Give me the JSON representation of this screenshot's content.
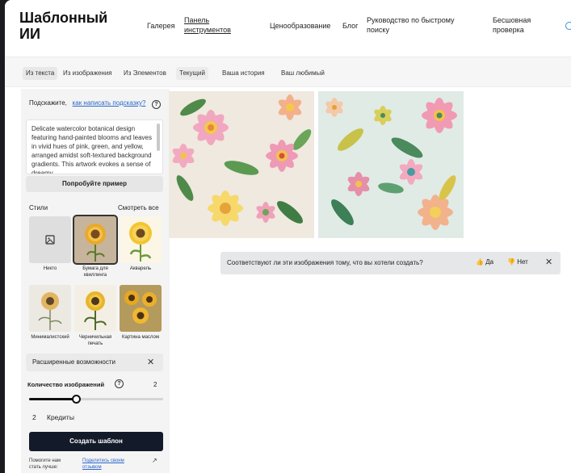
{
  "app": {
    "brand": "Шаблонный ИИ"
  },
  "nav": {
    "gallery": "Галерея",
    "dashboard": "Панель инструментов",
    "pricing": "Ценообразование",
    "blog": "Блог",
    "quick_guide": "Руководство по быстрому поиску",
    "seamless_check": "Бесшовная проверка"
  },
  "tabs": {
    "source": [
      "Из текста",
      "Из изображения",
      "Из Элементов"
    ],
    "history": [
      "Текущий",
      "Ваша история",
      "Ваш любимый"
    ]
  },
  "prompt": {
    "hint_prefix": "Подскажите,",
    "hint_link": "как написать подсказку?",
    "text": "Delicate watercolor botanical design featuring hand-painted blooms and leaves in vivid hues of pink, green, and yellow, arranged amidst soft-textured background gradients. This artwork evokes a sense of dreamy",
    "try_example": "Попробуйте пример"
  },
  "styles": {
    "label": "Стили",
    "see_all": "Смотреть все",
    "items": [
      {
        "label": "Никто"
      },
      {
        "label": "Бумага для квиллинга"
      },
      {
        "label": "Акварель"
      },
      {
        "label": "Минималистский"
      },
      {
        "label": "Черничильная печать"
      },
      {
        "label": "Картина маслом"
      }
    ]
  },
  "advanced": {
    "label": "Расширенные возможности"
  },
  "count": {
    "label": "Количество изображений",
    "value": "2",
    "slider_fraction": 0.35
  },
  "credits": {
    "number": "2",
    "label": "Кредиты"
  },
  "create_button": "Создать шаблон",
  "footer": {
    "left": "Помогите нам стать лучше:",
    "link": "Поделитесь своим отзывом"
  },
  "feedback": {
    "question": "Соответствуют ли эти изображения тому, что вы хотели создать?",
    "yes": "Да",
    "no": "Нет"
  },
  "colors": {
    "create_button": "#131a2a",
    "link": "#2a66c9",
    "feedback_bg": "#e6e7e9"
  }
}
